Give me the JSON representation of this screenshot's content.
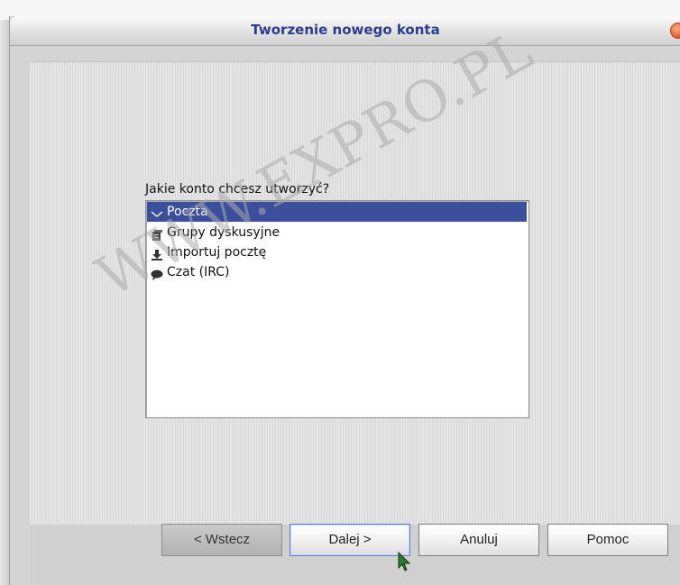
{
  "window": {
    "title": "Tworzenie nowego konta"
  },
  "prompt": {
    "question": "Jakie konto chcesz utworzyć?"
  },
  "account_list": {
    "selected_index": 0,
    "items": [
      {
        "label": "Poczta",
        "icon": "envelope-icon"
      },
      {
        "label": "Grupy dyskusyjne",
        "icon": "newsgroup-icon"
      },
      {
        "label": "Importuj pocztę",
        "icon": "import-icon"
      },
      {
        "label": "Czat (IRC)",
        "icon": "chat-bubble-icon"
      }
    ]
  },
  "buttons": {
    "back_label": "< Wstecz",
    "next_label": "Dalej >",
    "cancel_label": "Anuluj",
    "help_label": "Pomoc"
  },
  "watermark": {
    "text": "WWW.EXPRO.PL"
  },
  "colors": {
    "title_text": "#2a3d8f",
    "selection": "#3b4f9c",
    "close_button": "#e0552a"
  }
}
